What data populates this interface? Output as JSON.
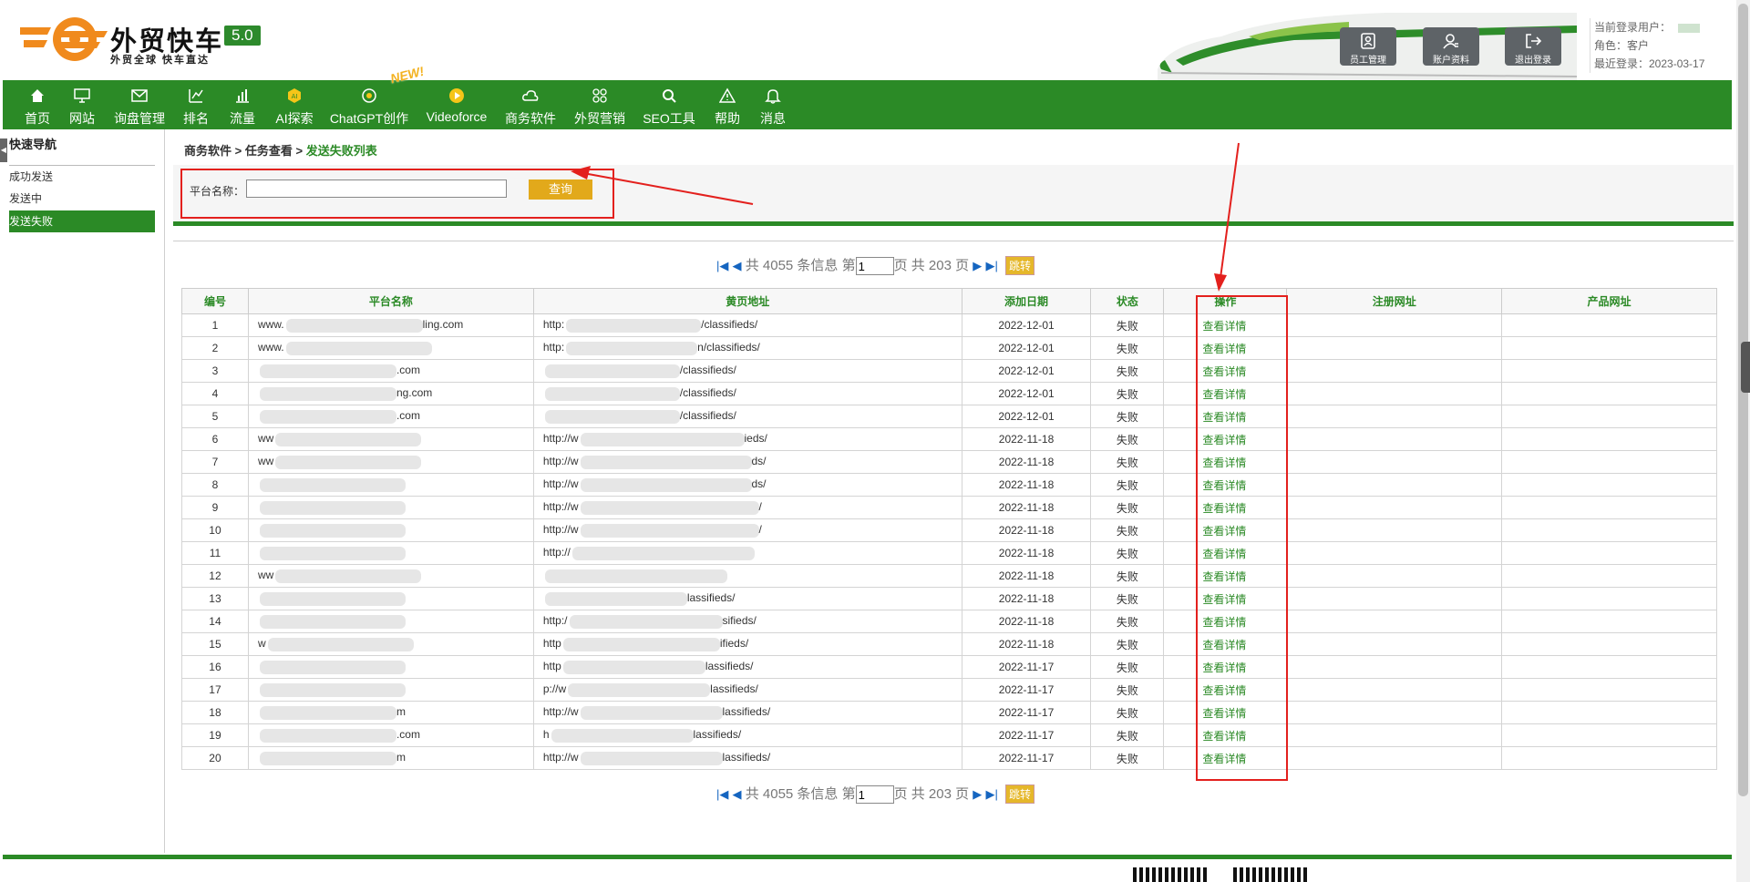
{
  "header": {
    "brand_name": "外贸快车",
    "brand_version": "5.0",
    "brand_tagline": "外贸全球 快车直达",
    "buttons": [
      {
        "label": "员工管理",
        "icon": "staff-icon"
      },
      {
        "label": "账户资料",
        "icon": "account-icon"
      },
      {
        "label": "退出登录",
        "icon": "logout-icon"
      }
    ],
    "user": {
      "current_user_label": "当前登录用户：",
      "role_label": "角色：客户",
      "last_login_label": "最近登录：2023-03-17"
    }
  },
  "nav": {
    "new_badge": "NEW!",
    "items": [
      {
        "label": "首页",
        "icon": "home-icon"
      },
      {
        "label": "网站",
        "icon": "monitor-icon"
      },
      {
        "label": "询盘管理",
        "icon": "mail-icon"
      },
      {
        "label": "排名",
        "icon": "rank-icon"
      },
      {
        "label": "流量",
        "icon": "bar-chart-icon"
      },
      {
        "label": "AI探索",
        "icon": "ai-icon"
      },
      {
        "label": "ChatGPT创作",
        "icon": "chatgpt-icon"
      },
      {
        "label": "Videoforce",
        "icon": "video-icon"
      },
      {
        "label": "商务软件",
        "icon": "cloud-icon"
      },
      {
        "label": "外贸营销",
        "icon": "marketing-icon"
      },
      {
        "label": "SEO工具",
        "icon": "search-icon"
      },
      {
        "label": "帮助",
        "icon": "warning-icon"
      },
      {
        "label": "消息",
        "icon": "bell-icon"
      }
    ]
  },
  "sidebar": {
    "title": "快速导航",
    "items": [
      {
        "label": "成功发送",
        "active": false
      },
      {
        "label": "发送中",
        "active": false
      },
      {
        "label": "发送失败",
        "active": true
      }
    ]
  },
  "breadcrumb": {
    "part1": "商务软件",
    "sep": ">",
    "part2": "任务查看",
    "current": "发送失败列表"
  },
  "search": {
    "label": "平台名称：",
    "value": "",
    "button": "查询"
  },
  "pager": {
    "total_text": "共 4055 条信息 第",
    "page_value": "1",
    "pages_text": "页 共 203 页",
    "go_label": "跳转"
  },
  "table": {
    "headers": [
      "编号",
      "平台名称",
      "黄页地址",
      "添加日期",
      "状态",
      "操作",
      "注册网址",
      "产品网址"
    ],
    "rows": [
      {
        "no": "1",
        "platform": "www.",
        "platform_tail": "ling.com",
        "url": "http:",
        "url_tail": "/classifieds/",
        "date": "2022-12-01",
        "status": "失败",
        "action": "查看详情"
      },
      {
        "no": "2",
        "platform": "www.",
        "platform_tail": "",
        "url": "http:",
        "url_tail": "n/classifieds/",
        "date": "2022-12-01",
        "status": "失败",
        "action": "查看详情"
      },
      {
        "no": "3",
        "platform": "",
        "platform_tail": ".com",
        "url": "",
        "url_tail": "/classifieds/",
        "date": "2022-12-01",
        "status": "失败",
        "action": "查看详情"
      },
      {
        "no": "4",
        "platform": "",
        "platform_tail": "ng.com",
        "url": "",
        "url_tail": "/classifieds/",
        "date": "2022-12-01",
        "status": "失败",
        "action": "查看详情"
      },
      {
        "no": "5",
        "platform": "",
        "platform_tail": ".com",
        "url": "",
        "url_tail": "/classifieds/",
        "date": "2022-12-01",
        "status": "失败",
        "action": "查看详情"
      },
      {
        "no": "6",
        "platform": "ww",
        "platform_tail": "",
        "url": "http://w",
        "url_tail": "ieds/",
        "date": "2022-11-18",
        "status": "失败",
        "action": "查看详情"
      },
      {
        "no": "7",
        "platform": "ww",
        "platform_tail": "",
        "url": "http://w",
        "url_tail": "ds/",
        "date": "2022-11-18",
        "status": "失败",
        "action": "查看详情"
      },
      {
        "no": "8",
        "platform": "",
        "platform_tail": "",
        "url": "http://w",
        "url_tail": "ds/",
        "date": "2022-11-18",
        "status": "失败",
        "action": "查看详情"
      },
      {
        "no": "9",
        "platform": "",
        "platform_tail": "",
        "url": "http://w",
        "url_tail": "/",
        "date": "2022-11-18",
        "status": "失败",
        "action": "查看详情"
      },
      {
        "no": "10",
        "platform": "",
        "platform_tail": "",
        "url": "http://w",
        "url_tail": "/",
        "date": "2022-11-18",
        "status": "失败",
        "action": "查看详情"
      },
      {
        "no": "11",
        "platform": "",
        "platform_tail": "",
        "url": "http://",
        "url_tail": "",
        "date": "2022-11-18",
        "status": "失败",
        "action": "查看详情"
      },
      {
        "no": "12",
        "platform": "ww",
        "platform_tail": "",
        "url": "",
        "url_tail": "",
        "date": "2022-11-18",
        "status": "失败",
        "action": "查看详情"
      },
      {
        "no": "13",
        "platform": "",
        "platform_tail": "",
        "url": "",
        "url_tail": "lassifieds/",
        "date": "2022-11-18",
        "status": "失败",
        "action": "查看详情"
      },
      {
        "no": "14",
        "platform": "",
        "platform_tail": "",
        "url": "http:/",
        "url_tail": "sifieds/",
        "date": "2022-11-18",
        "status": "失败",
        "action": "查看详情"
      },
      {
        "no": "15",
        "platform": "w",
        "platform_tail": "",
        "url": "http",
        "url_tail": "ifieds/",
        "date": "2022-11-18",
        "status": "失败",
        "action": "查看详情"
      },
      {
        "no": "16",
        "platform": "",
        "platform_tail": "",
        "url": "http",
        "url_tail": "lassifieds/",
        "date": "2022-11-17",
        "status": "失败",
        "action": "查看详情"
      },
      {
        "no": "17",
        "platform": "",
        "platform_tail": "",
        "url": "p://w",
        "url_tail": "lassifieds/",
        "date": "2022-11-17",
        "status": "失败",
        "action": "查看详情"
      },
      {
        "no": "18",
        "platform": "",
        "platform_tail": "m",
        "url": "http://w",
        "url_tail": "lassifieds/",
        "date": "2022-11-17",
        "status": "失败",
        "action": "查看详情"
      },
      {
        "no": "19",
        "platform": "",
        "platform_tail": ".com",
        "url": "h",
        "url_tail": "lassifieds/",
        "date": "2022-11-17",
        "status": "失败",
        "action": "查看详情"
      },
      {
        "no": "20",
        "platform": "",
        "platform_tail": "m",
        "url": "http://w",
        "url_tail": "lassifieds/",
        "date": "2022-11-17",
        "status": "失败",
        "action": "查看详情"
      }
    ]
  },
  "colors": {
    "brand_green": "#2b8a26",
    "accent_orange": "#e2a91b",
    "annotation_red": "#e3201d"
  }
}
